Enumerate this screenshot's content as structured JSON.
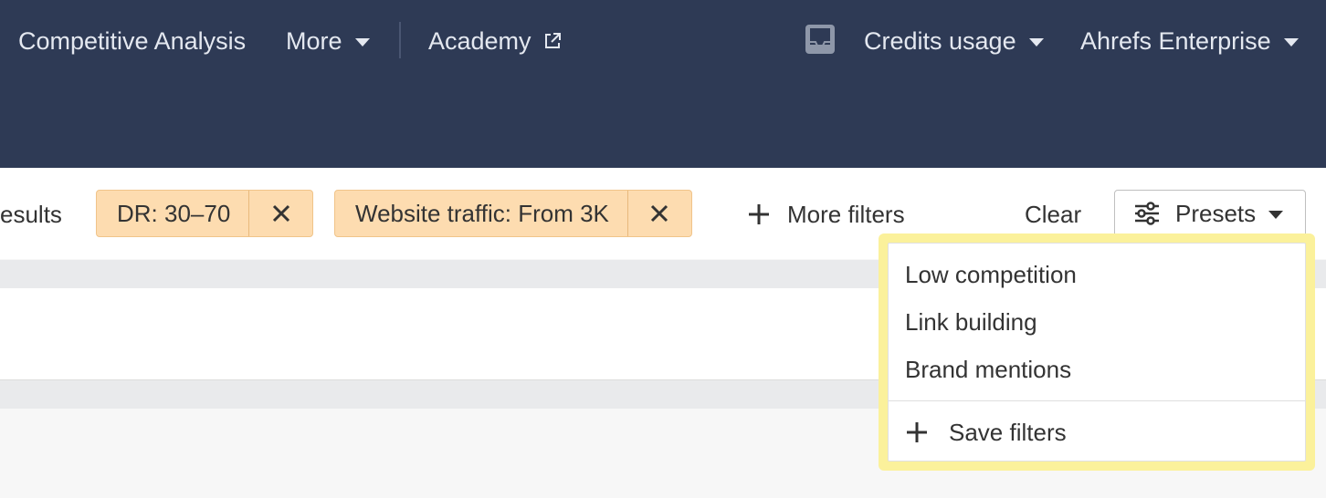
{
  "topnav": {
    "competitive_analysis": "Competitive Analysis",
    "more": "More",
    "academy": "Academy",
    "credits_usage": "Credits usage",
    "account": "Ahrefs Enterprise"
  },
  "filters": {
    "results_text": "esults",
    "chips": [
      {
        "label": "DR: 30–70"
      },
      {
        "label": "Website traffic: From 3K"
      }
    ],
    "more_filters": "More filters",
    "clear": "Clear",
    "presets": "Presets"
  },
  "presets_menu": {
    "items": [
      "Low competition",
      "Link building",
      "Brand mentions"
    ],
    "save": "Save filters"
  },
  "colors": {
    "topbar": "#2e3a55",
    "chip_bg": "#fddcb0",
    "highlight": "#fbf19b"
  },
  "icons": [
    "external-link-icon",
    "inbox-icon",
    "close-icon",
    "plus-icon",
    "sliders-icon",
    "chevron-down-icon"
  ]
}
